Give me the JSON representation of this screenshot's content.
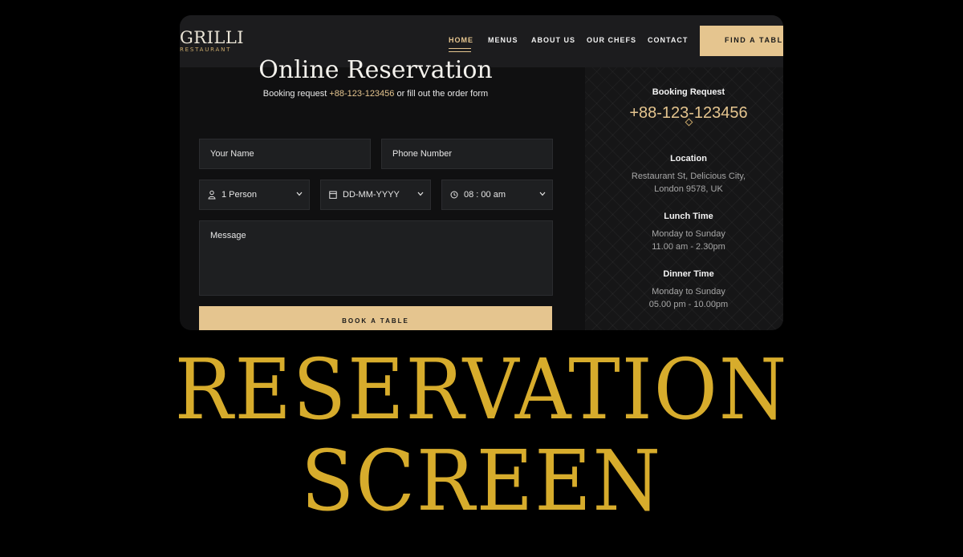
{
  "header": {
    "logo_main": "GRILLI",
    "logo_sub": "RESTAURANT",
    "nav": [
      "HOME",
      "MENUS",
      "ABOUT US",
      "OUR CHEFS",
      "CONTACT"
    ],
    "cta": "FIND A TABLE",
    "active_nav": "HOME"
  },
  "form": {
    "heading": "Online Reservation",
    "subline_prefix": "Booking request ",
    "subline_phone": "+88-123-123456",
    "subline_suffix": " or fill out the order form",
    "name_placeholder": "Your Name",
    "phone_placeholder": "Phone Number",
    "persons_value": "1 Person",
    "date_value": "DD-MM-YYYY",
    "time_value": "08 : 00 am",
    "message_placeholder": "Message",
    "submit_label": "BOOK A TABLE"
  },
  "info": {
    "booking_title": "Booking Request",
    "booking_phone": "+88-123-123456",
    "location_title": "Location",
    "location_line1": "Restaurant St, Delicious City,",
    "location_line2": "London 9578, UK",
    "lunch_title": "Lunch Time",
    "lunch_days": "Monday to Sunday",
    "lunch_hours": "11.00 am - 2.30pm",
    "dinner_title": "Dinner Time",
    "dinner_days": "Monday to Sunday",
    "dinner_hours": "05.00 pm - 10.00pm"
  },
  "caption": {
    "line1": "RESERVATION",
    "line2": "SCREEN"
  },
  "colors": {
    "accent": "#e5c58f",
    "caption": "#d7ac2c",
    "background": "#000000"
  },
  "icons": [
    "user-icon",
    "calendar-icon",
    "clock-icon",
    "chevron-down-icon",
    "diamond-icon"
  ]
}
